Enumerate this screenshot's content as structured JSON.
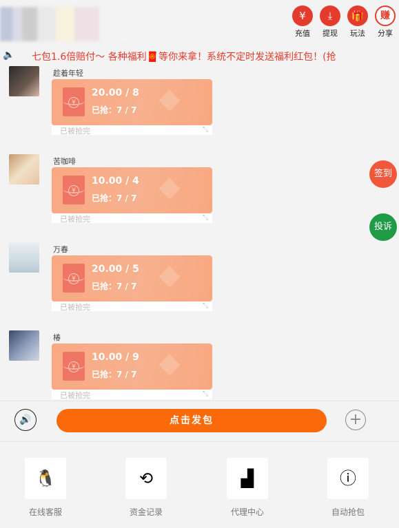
{
  "header": {
    "actions": [
      {
        "icon": "yuan-icon",
        "glyph": "¥",
        "label": "充值"
      },
      {
        "icon": "withdraw-icon",
        "glyph": "⤓",
        "label": "提现"
      },
      {
        "icon": "gift-icon",
        "glyph": "🎁",
        "label": "玩法"
      },
      {
        "icon": "share-icon",
        "glyph": "赚",
        "label": "分享"
      }
    ]
  },
  "notice": {
    "text": "七包1.6倍赔付～ 各种福利🧧等你来拿！系统不定时发送福利红包！(抢"
  },
  "messages": [
    {
      "name": "趁着年轻",
      "amount": "20.00 / 8",
      "grabbed": "已抢：7 / 7",
      "status": "已被抢完"
    },
    {
      "name": "苦咖啡",
      "amount": "10.00 / 4",
      "grabbed": "已抢：7 / 7",
      "status": "已被抢完"
    },
    {
      "name": "万春",
      "amount": "20.00 / 5",
      "grabbed": "已抢：7 / 7",
      "status": "已被抢完"
    },
    {
      "name": "椿",
      "amount": "10.00 / 9",
      "grabbed": "已抢：7 / 7",
      "status": "已被抢完"
    }
  ],
  "float": {
    "checkin": "签到",
    "complain": "投诉"
  },
  "composer": {
    "send_label": "点击发包"
  },
  "dock": [
    {
      "label": "在线客服",
      "icon": "qq-penguin-icon",
      "glyph": "🐧"
    },
    {
      "label": "资金记录",
      "icon": "money-cycle-icon",
      "glyph": "⟲"
    },
    {
      "label": "代理中心",
      "icon": "agent-podium-icon",
      "glyph": "▟"
    },
    {
      "label": "自动抢包",
      "icon": "info-icon",
      "glyph": "ⓘ"
    }
  ],
  "colors": {
    "accent": "#e53b2c",
    "send": "#fb6a0a",
    "packet": "#f9a882",
    "checkin": "#f0573b",
    "complain": "#1f9a47"
  }
}
